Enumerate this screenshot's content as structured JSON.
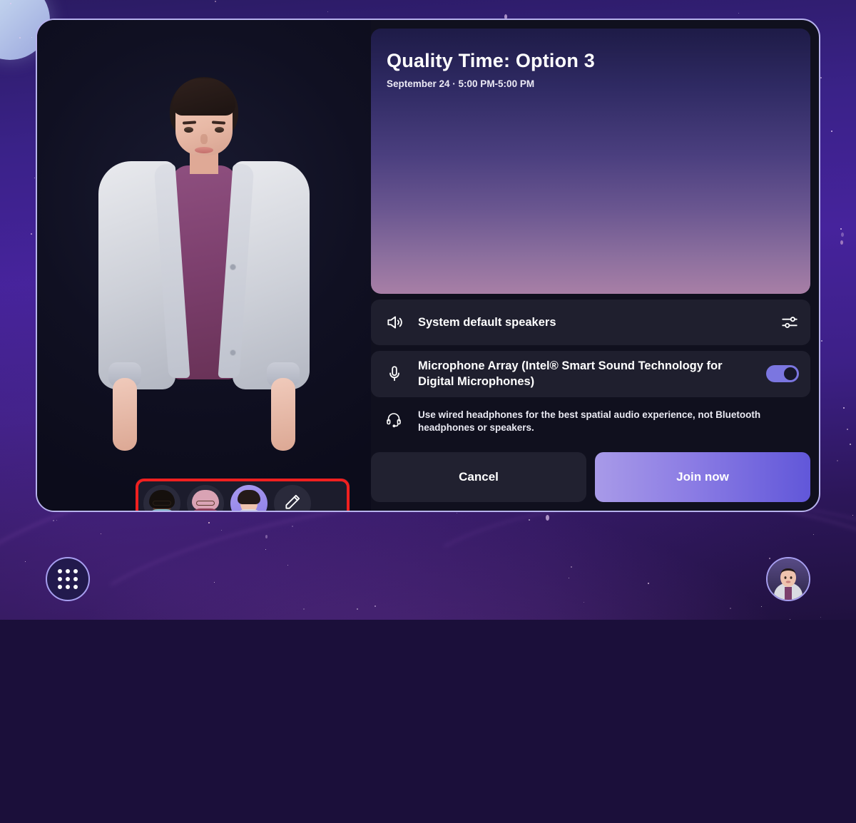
{
  "meeting": {
    "title": "Quality Time: Option 3",
    "subtitle": "September 24 · 5:00 PM-5:00 PM"
  },
  "devices": {
    "speaker": {
      "icon": "speaker-icon",
      "label": "System default speakers",
      "action_icon": "audio-settings-sliders-icon"
    },
    "microphone": {
      "icon": "microphone-icon",
      "label": "Microphone Array (Intel® Smart Sound Technology for Digital Microphones)",
      "toggle_on": true,
      "toggle_color": "#7b76e0"
    },
    "hint": {
      "icon": "headset-icon",
      "text": "Use wired headphones for the best spatial audio experience, not Bluetooth headphones or speakers."
    }
  },
  "actions": {
    "cancel_label": "Cancel",
    "join_label": "Join now",
    "join_gradient": [
      "#a89ae8",
      "#6157d9"
    ]
  },
  "avatar_chooser": {
    "highlight_color": "#f02020",
    "items": [
      {
        "name": "avatar-option-1",
        "selected": false,
        "skin": "#6b4331",
        "hair": "#15100d",
        "top": "#7fbccb",
        "glasses": true
      },
      {
        "name": "avatar-option-2",
        "selected": false,
        "skin": "#e8b49f",
        "hair": "#d9a3b4",
        "top": "#8e3f5a",
        "glasses": true
      },
      {
        "name": "avatar-option-3",
        "selected": true,
        "skin": "#eec3ae",
        "hair": "#241a18",
        "top": "#7c3f6d",
        "glasses": false
      }
    ],
    "edit_button": {
      "name": "edit-avatar-button",
      "icon": "pencil-icon"
    }
  },
  "taskbar": {
    "apps_button": {
      "name": "apps-grid-button",
      "icon": "apps-grid-icon"
    },
    "profile_button": {
      "name": "profile-avatar-button",
      "icon": "avatar-icon"
    }
  },
  "preview": {
    "gradient_top": "#1e1b47",
    "gradient_bottom": "#a87fa6"
  },
  "dialog": {
    "border_color": "#b7b2ee",
    "background": "#10101e"
  }
}
